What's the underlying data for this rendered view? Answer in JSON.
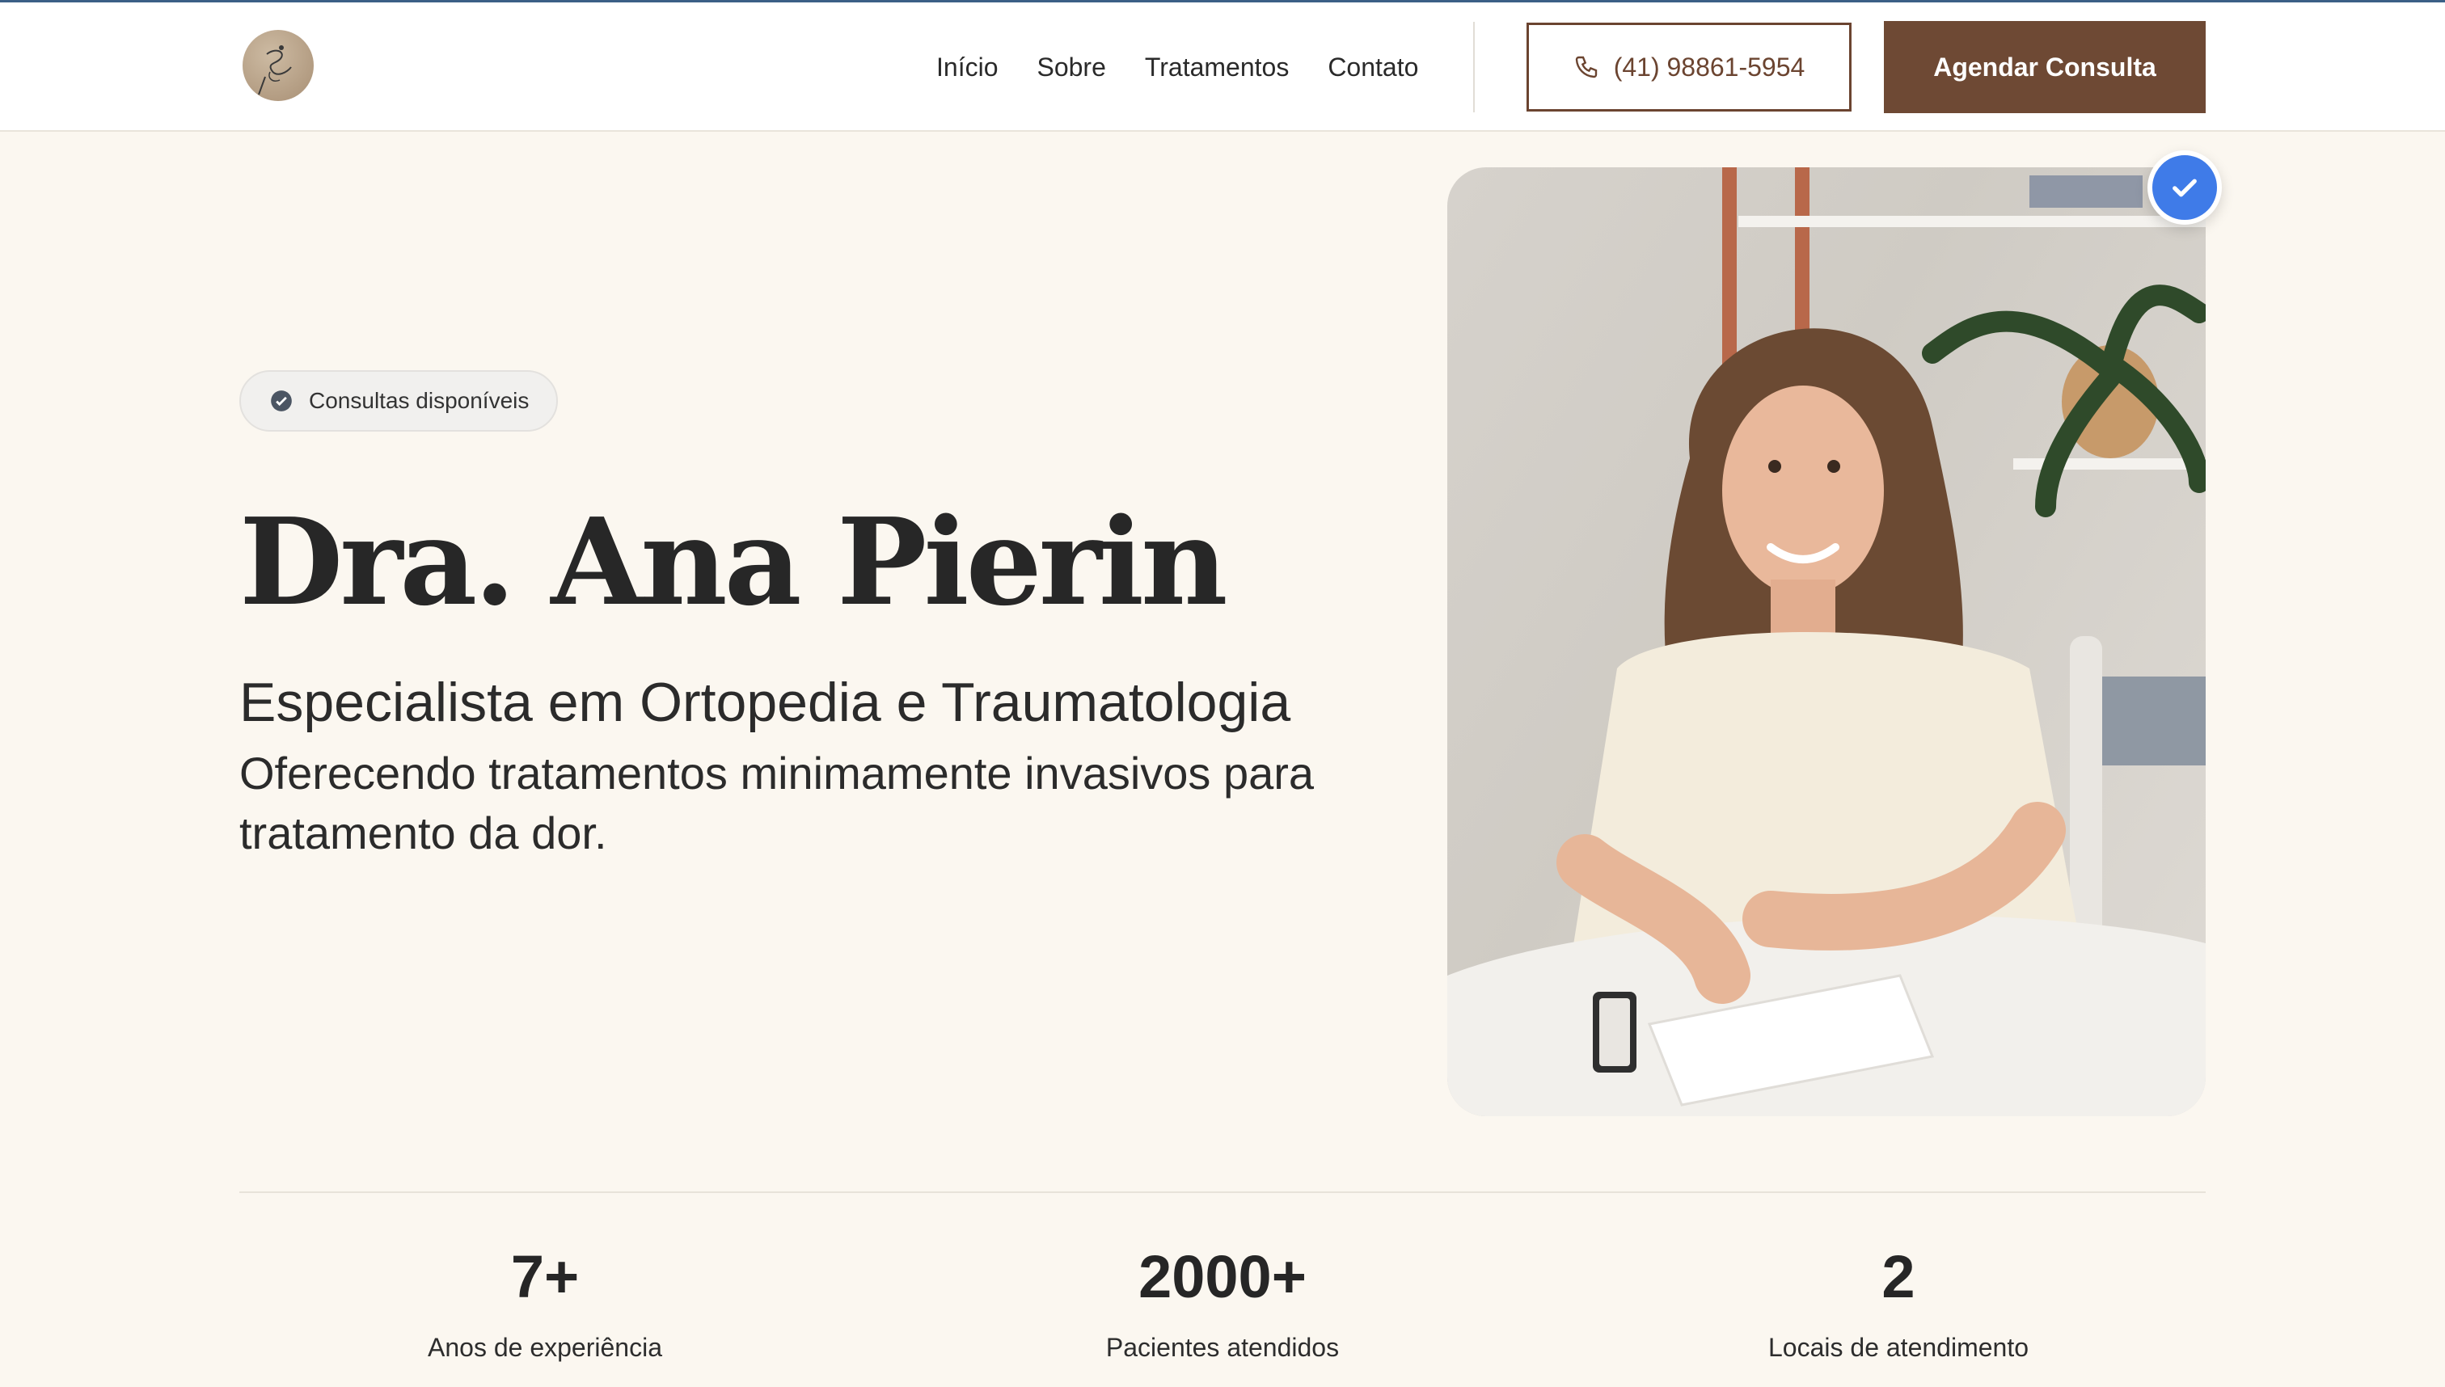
{
  "header": {
    "logo_alt": "logo",
    "nav": [
      "Início",
      "Sobre",
      "Tratamentos",
      "Contato"
    ],
    "phone": "(41) 98861-5954",
    "cta": "Agendar Consulta"
  },
  "hero": {
    "badge": "Consultas disponíveis",
    "name": "Dra. Ana Pierin",
    "subtitle": "Especialista em Ortopedia e Traumatologia",
    "description": "Oferecendo tratamentos minimamente invasivos para tratamento da dor."
  },
  "stats": [
    {
      "value": "7+",
      "label": "Anos de experiência"
    },
    {
      "value": "2000+",
      "label": "Pacientes atendidos"
    },
    {
      "value": "2",
      "label": "Locais de atendimento"
    }
  ],
  "colors": {
    "brand": "#6e4934",
    "verified": "#3f7be8",
    "background": "#fbf7f0"
  }
}
